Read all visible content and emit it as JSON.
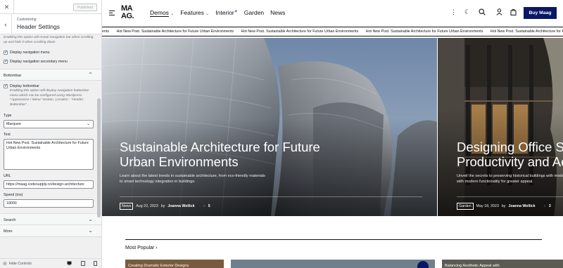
{
  "customizer": {
    "close_icon": "close-icon",
    "published_label": "Published",
    "breadcrumb": "Customizing",
    "title": "Header Settings",
    "top_description": "Enabling this option will reveal navigation bar when scrolling up and hide it when scrolling down.",
    "options": [
      {
        "label": "Display navigation menu",
        "checked": true
      },
      {
        "label": "Display navigation secondary menu",
        "checked": true
      }
    ],
    "bottombar": {
      "section_label": "Bottombar",
      "checkbox_label": "Display bottombar",
      "description": "Enabling this option will display navigation bottombar menu which can be configured using Wordpress \"Appearance / Menu\" section, Location - \"Header Bottombar\".",
      "type_label": "Type",
      "type_value": "Marquee",
      "text_label": "Text",
      "text_value": "Hot New Post. Sustainable Architecture for Future Urban Environments",
      "url_label": "URL",
      "url_value": "https://maag.codesupply.co/design-architecture",
      "speed_label": "Speed (ms)",
      "speed_value": "18000"
    },
    "sections_below": [
      "Search",
      "More"
    ],
    "hide_controls_label": "Hide Controls"
  },
  "site": {
    "logo_line1": "MA",
    "logo_line2": "AG.",
    "nav": [
      {
        "label": "Demos",
        "chevron": true
      },
      {
        "label": "Features",
        "chevron": true
      },
      {
        "label": "Interior",
        "star": true
      },
      {
        "label": "Garden"
      },
      {
        "label": "News"
      }
    ],
    "nav_star": "✦",
    "buy_label": "Buy Maag",
    "ticker_text": "Hot New Post. Sustainable Architecture for Future Urban Environments",
    "ticker_lead": "ents",
    "slides": [
      {
        "title": "Sustainable Architecture for Future Urban Environments",
        "subtitle": "Learn about the latest trends in sustainable architecture, from eco-friendly materials to smart technology integration in buildings.",
        "category": "News",
        "date": "Aug 22, 2023",
        "by": "by",
        "author": "Joanna Wellick",
        "comments": "5"
      },
      {
        "title": "Designing Office Spaces for Productivity and Aesthetics",
        "subtitle": "Unveil the secrets to preserving historical buildings with modern updates that blend old-world charm with modern functionality for greater appeal.",
        "category": "Garden",
        "date": "May 18, 2023",
        "by": "by",
        "author": "Joanna Wellick",
        "comments": "3"
      }
    ],
    "most_popular_label": "Most Popular",
    "cards": [
      {
        "title": "Creating Dramatic Exterior Designs"
      },
      {
        "title": ""
      },
      {
        "title": "Balancing Aesthetic Appeal with"
      }
    ]
  }
}
